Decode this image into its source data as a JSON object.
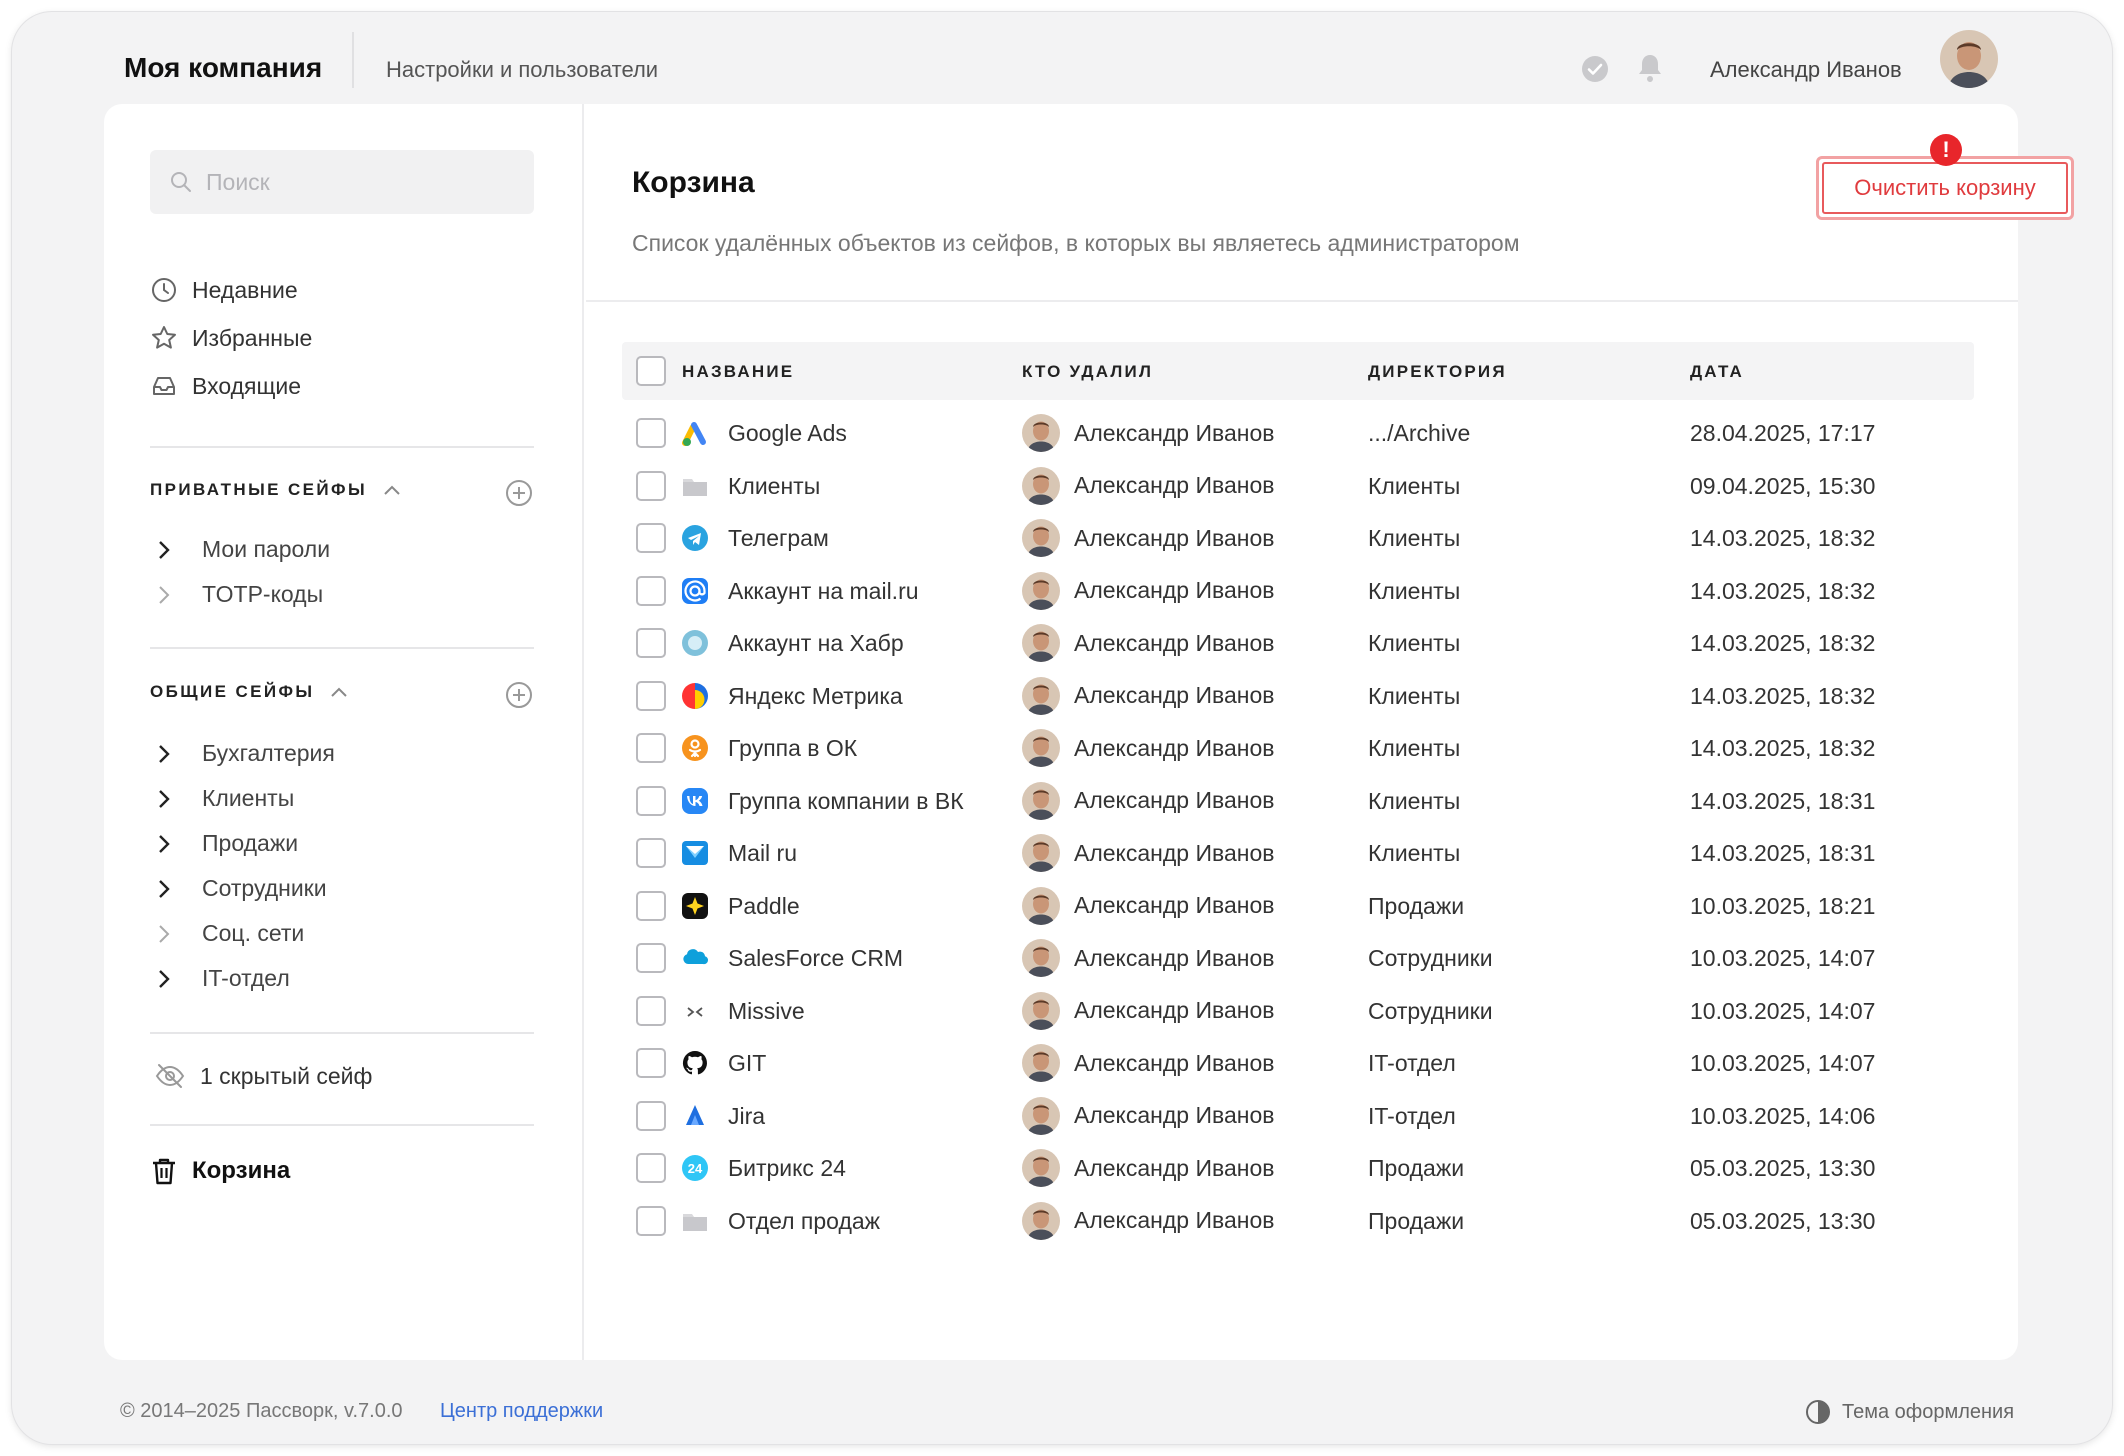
{
  "topbar": {
    "brand": "Моя компания",
    "subtitle": "Настройки и пользователи",
    "username": "Александр Иванов"
  },
  "sidebar": {
    "search_placeholder": "Поиск",
    "nav": [
      {
        "label": "Недавние",
        "icon": "clock-icon"
      },
      {
        "label": "Избранные",
        "icon": "star-icon"
      },
      {
        "label": "Входящие",
        "icon": "inbox-icon"
      }
    ],
    "private_title": "ПРИВАТНЫЕ СЕЙФЫ",
    "private_items": [
      "Мои пароли",
      "TOTP-коды"
    ],
    "shared_title": "ОБЩИЕ СЕЙФЫ",
    "shared_items": [
      "Бухгалтерия",
      "Клиенты",
      "Продажи",
      "Сотрудники",
      "Соц. сети",
      "IT-отдел"
    ],
    "hidden_label": "1 скрытый сейф",
    "trash_label": "Корзина"
  },
  "content": {
    "title": "Корзина",
    "description": "Список удалённых объектов из сейфов, в которых вы являетесь администратором",
    "clear_button": "Очистить корзину",
    "badge": "!",
    "columns": [
      "НАЗВАНИЕ",
      "КТО УДАЛИЛ",
      "ДИРЕКТОРИЯ",
      "ДАТА"
    ],
    "rows": [
      {
        "name": "Google Ads",
        "icon": "google-ads-icon",
        "who": "Александр Иванов",
        "dir": ".../Archive",
        "date": "28.04.2025, 17:17"
      },
      {
        "name": "Клиенты",
        "icon": "folder-icon",
        "who": "Александр Иванов",
        "dir": "Клиенты",
        "date": "09.04.2025, 15:30"
      },
      {
        "name": "Телеграм",
        "icon": "telegram-icon",
        "who": "Александр Иванов",
        "dir": "Клиенты",
        "date": "14.03.2025, 18:32"
      },
      {
        "name": "Аккаунт на mail.ru",
        "icon": "at-sign-icon",
        "who": "Александр Иванов",
        "dir": "Клиенты",
        "date": "14.03.2025, 18:32"
      },
      {
        "name": "Аккаунт на Хабр",
        "icon": "habr-icon",
        "who": "Александр Иванов",
        "dir": "Клиенты",
        "date": "14.03.2025, 18:32"
      },
      {
        "name": "Яндекс Метрика",
        "icon": "yandex-metrika-icon",
        "who": "Александр Иванов",
        "dir": "Клиенты",
        "date": "14.03.2025, 18:32"
      },
      {
        "name": "Группа в ОК",
        "icon": "odnoklassniki-icon",
        "who": "Александр Иванов",
        "dir": "Клиенты",
        "date": "14.03.2025, 18:32"
      },
      {
        "name": "Группа компании в ВК",
        "icon": "vk-icon",
        "who": "Александр Иванов",
        "dir": "Клиенты",
        "date": "14.03.2025, 18:31"
      },
      {
        "name": "Mail ru",
        "icon": "mailru-icon",
        "who": "Александр Иванов",
        "dir": "Клиенты",
        "date": "14.03.2025, 18:31"
      },
      {
        "name": "Paddle",
        "icon": "paddle-icon",
        "who": "Александр Иванов",
        "dir": "Продажи",
        "date": "10.03.2025, 18:21"
      },
      {
        "name": "SalesForce CRM",
        "icon": "salesforce-icon",
        "who": "Александр Иванов",
        "dir": "Сотрудники",
        "date": "10.03.2025, 14:07"
      },
      {
        "name": "Missive",
        "icon": "missive-icon",
        "who": "Александр Иванов",
        "dir": "Сотрудники",
        "date": "10.03.2025, 14:07"
      },
      {
        "name": "GIT",
        "icon": "github-icon",
        "who": "Александр Иванов",
        "dir": "IT-отдел",
        "date": "10.03.2025, 14:07"
      },
      {
        "name": "Jira",
        "icon": "jira-icon",
        "who": "Александр Иванов",
        "dir": "IT-отдел",
        "date": "10.03.2025, 14:06"
      },
      {
        "name": "Битрикс 24",
        "icon": "bitrix24-icon",
        "who": "Александр Иванов",
        "dir": "Продажи",
        "date": "05.03.2025, 13:30"
      },
      {
        "name": "Отдел продаж",
        "icon": "folder-icon",
        "who": "Александр Иванов",
        "dir": "Продажи",
        "date": "05.03.2025, 13:30"
      }
    ]
  },
  "footer": {
    "copyright": "© 2014–2025 Пассворк, v.7.0.0",
    "support": "Центр поддержки",
    "theme": "Тема оформления"
  },
  "colors": {
    "accent_red": "#e03b3e",
    "link_blue": "#3b6fd6",
    "background": "#f3f3f4"
  }
}
